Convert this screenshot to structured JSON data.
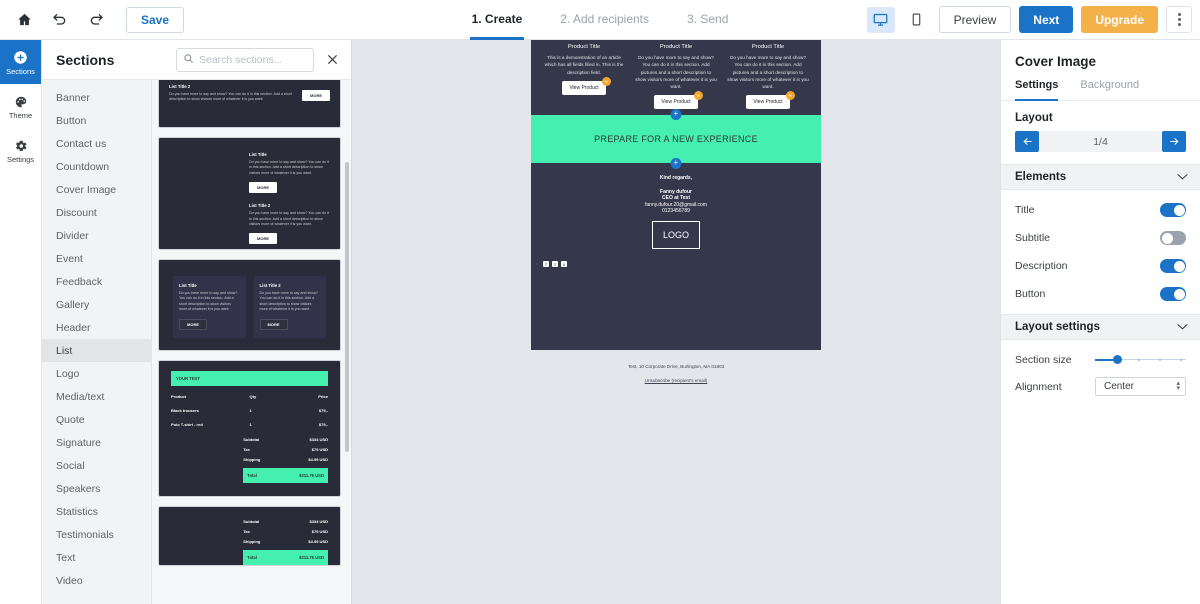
{
  "toolbar": {
    "home_icon": "home-icon",
    "undo_icon": "undo-icon",
    "redo_icon": "redo-icon",
    "save_label": "Save",
    "steps": [
      {
        "label": "1. Create",
        "active": true
      },
      {
        "label": "2. Add recipients",
        "active": false
      },
      {
        "label": "3. Send",
        "active": false
      }
    ],
    "desktop_icon": "desktop-icon",
    "mobile_icon": "mobile-icon",
    "preview_label": "Preview",
    "next_label": "Next",
    "upgrade_label": "Upgrade",
    "more_icon": "kebab-menu-icon"
  },
  "rail": {
    "items": [
      {
        "label": "Sections",
        "icon": "plus-circle-icon",
        "active": true
      },
      {
        "label": "Theme",
        "icon": "palette-icon",
        "active": false
      },
      {
        "label": "Settings",
        "icon": "gear-icon",
        "active": false
      }
    ]
  },
  "sections_panel": {
    "title": "Sections",
    "search_placeholder": "Search sections...",
    "search_value": "",
    "search_icon": "search-icon",
    "close_icon": "close-icon",
    "items": [
      {
        "label": "Banner",
        "selected": false
      },
      {
        "label": "Button",
        "selected": false
      },
      {
        "label": "Contact us",
        "selected": false
      },
      {
        "label": "Countdown",
        "selected": false
      },
      {
        "label": "Cover Image",
        "selected": false
      },
      {
        "label": "Discount",
        "selected": false
      },
      {
        "label": "Divider",
        "selected": false
      },
      {
        "label": "Event",
        "selected": false
      },
      {
        "label": "Feedback",
        "selected": false
      },
      {
        "label": "Gallery",
        "selected": false
      },
      {
        "label": "Header",
        "selected": false
      },
      {
        "label": "List",
        "selected": true
      },
      {
        "label": "Logo",
        "selected": false
      },
      {
        "label": "Media/text",
        "selected": false
      },
      {
        "label": "Quote",
        "selected": false
      },
      {
        "label": "Signature",
        "selected": false
      },
      {
        "label": "Social",
        "selected": false
      },
      {
        "label": "Speakers",
        "selected": false
      },
      {
        "label": "Statistics",
        "selected": false
      },
      {
        "label": "Testimonials",
        "selected": false
      },
      {
        "label": "Text",
        "selected": false
      },
      {
        "label": "Video",
        "selected": false
      }
    ],
    "thumbs": {
      "list_title": "List Title",
      "list_title_2": "List Title 2",
      "list_body": "Do you have more to say and show? You can do it in this section. Add a short description to show visitors more of whatever it is you want.",
      "more_label": "MORE",
      "invoice": {
        "header": "YOUR TEXT",
        "columns": [
          "Product",
          "Qty",
          "Price"
        ],
        "rows": [
          {
            "product": "Black trousers",
            "qty": "1",
            "price": "$79,-"
          },
          {
            "product": "Polo T-shirt - red",
            "qty": "1",
            "price": "$79,-"
          }
        ],
        "totals": [
          {
            "label": "Subtotal",
            "value": "$334 USD"
          },
          {
            "label": "Tax",
            "value": "$79 USD"
          },
          {
            "label": "Shipping",
            "value": "$4.99 USD"
          }
        ],
        "total_label": "Total",
        "total_value": "$311.75 USD"
      }
    }
  },
  "email": {
    "products": [
      {
        "title": "Product Title",
        "body": "This is a demonstration of an article which has all fields filled in. This is the description field.",
        "button": "View Product",
        "badge": "%"
      },
      {
        "title": "Product Title",
        "body": "Do you have more to say and show? You can do it in this section. Add pictures and a short description to show visitors more of whatever it is you want.",
        "button": "View Product",
        "badge": "%"
      },
      {
        "title": "Product Title",
        "body": "Do you have more to say and show? You can do it in this section. Add pictures and a short description to show visitors more of whatever it is you want.",
        "button": "View Product",
        "badge": "%"
      }
    ],
    "banner_text": "PREPARE FOR A NEW EXPERIENCE",
    "banner_color": "#45efb0",
    "signature": {
      "greeting": "Kind regards,",
      "name": "Fanny dufour",
      "role": "CEO at Test",
      "email": "fanny.dufour.20@gmail.com",
      "phone": "0123456789",
      "logo_text": "LOGO"
    },
    "socials": [
      {
        "icon": "facebook-icon",
        "glyph": "f"
      },
      {
        "icon": "twitter-icon",
        "glyph": "t"
      },
      {
        "icon": "instagram-icon",
        "glyph": "o"
      }
    ],
    "footer": {
      "address": "Test, 10 Corporate Drive, Burlington, MA 01803",
      "unsubscribe": "Unsubscribe (recipient's email)"
    },
    "add_icon": "plus-icon"
  },
  "right_panel": {
    "title": "Cover Image",
    "tabs": [
      {
        "label": "Settings",
        "active": true
      },
      {
        "label": "Background",
        "active": false
      }
    ],
    "layout": {
      "title": "Layout",
      "prev_icon": "arrow-left-icon",
      "next_icon": "arrow-right-icon",
      "counter": "1/4"
    },
    "elements": {
      "title": "Elements",
      "chevron_icon": "chevron-down-icon",
      "toggles": [
        {
          "label": "Title",
          "on": true
        },
        {
          "label": "Subtitle",
          "on": false
        },
        {
          "label": "Description",
          "on": true
        },
        {
          "label": "Button",
          "on": true
        }
      ]
    },
    "layout_settings": {
      "title": "Layout settings",
      "chevron_icon": "chevron-down-icon",
      "section_size_label": "Section size",
      "section_size_value": "20",
      "alignment_label": "Alignment",
      "alignment_value": "Center"
    },
    "accent_color": "#1a73c7"
  }
}
